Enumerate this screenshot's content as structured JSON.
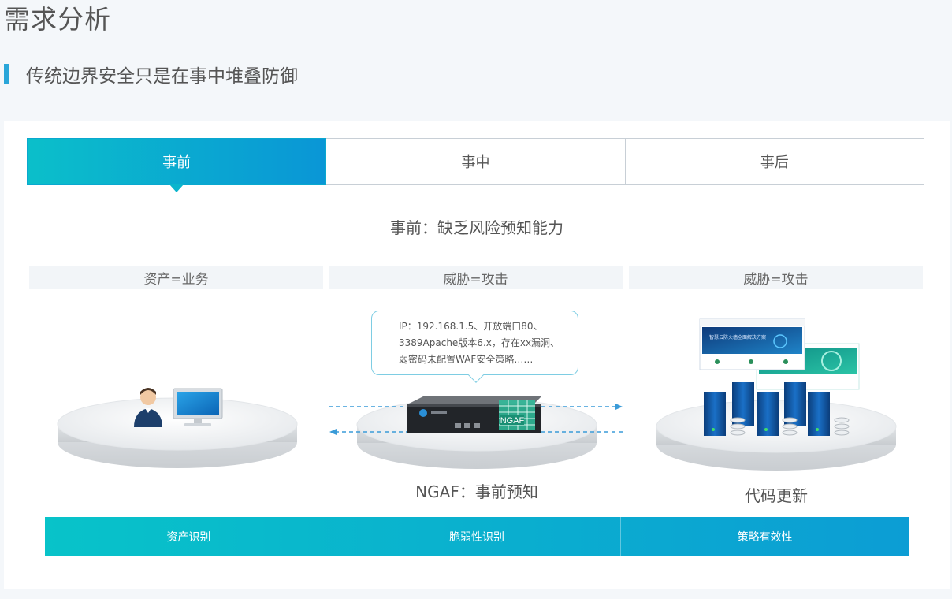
{
  "page": {
    "title": "需求分析"
  },
  "section": {
    "subtitle": "传统边界安全只是在事中堆叠防御"
  },
  "tabs": [
    {
      "label": "事前",
      "active": true
    },
    {
      "label": "事中",
      "active": false
    },
    {
      "label": "事后",
      "active": false
    }
  ],
  "content": {
    "headline": "事前：缺乏风险预知能力",
    "columns": [
      {
        "label": "资产=业务"
      },
      {
        "label": "威胁=攻击"
      },
      {
        "label": "威胁=攻击"
      }
    ],
    "bubble_text": "IP：192.168.1.5、开放端口80、3389Apache版本6.x，存在xx漏洞、弱密码未配置WAF安全策略……",
    "device_badge": "NGAF",
    "site_banner_text": "智慧云防火墙全面解决方案",
    "captions": {
      "middle": "NGAF：事前预知",
      "right": "代码更新"
    }
  },
  "bottom_bar": [
    {
      "label": "资产识别"
    },
    {
      "label": "脆弱性识别"
    },
    {
      "label": "策略有效性"
    }
  ],
  "colors": {
    "accent": "#2aa6d9",
    "gradient_start": "#0bbfca",
    "gradient_end": "#0a96d6"
  }
}
